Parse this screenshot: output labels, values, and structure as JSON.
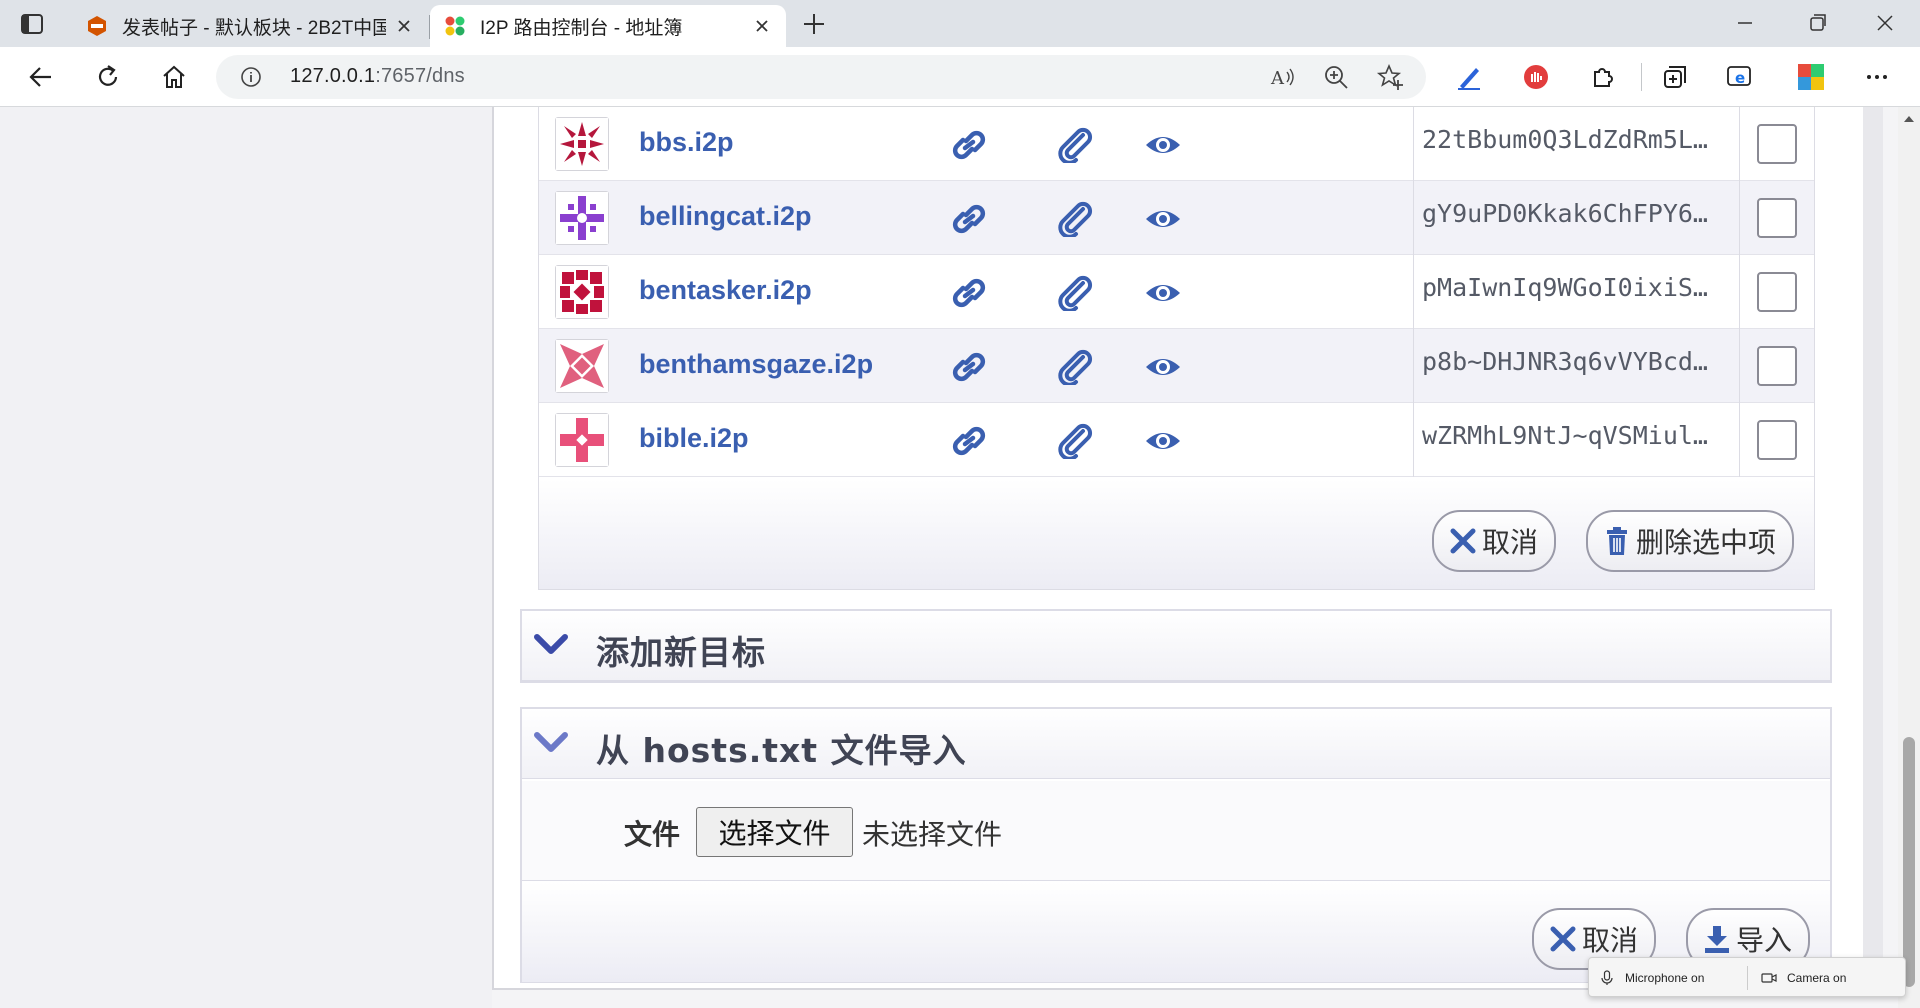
{
  "browser": {
    "tabs": [
      {
        "title": "发表帖子 - 默认板块 - 2B2T中国服",
        "active": false,
        "favicon": "forum-favicon"
      },
      {
        "title": "I2P 路由控制台 - 地址簿",
        "active": true,
        "favicon": "i2p-favicon"
      }
    ],
    "address": {
      "host": "127.0.0.1",
      "rest": ":7657/dns"
    },
    "toolbar_icons": [
      "back-icon",
      "refresh-icon",
      "home-icon",
      "read-aloud-icon",
      "zoom-icon",
      "favorite-add-icon",
      "pen-extension-icon",
      "stop-extension-icon",
      "extensions-icon",
      "collections-icon",
      "ie-mode-icon",
      "profile-icon",
      "more-icon"
    ]
  },
  "addressbook": {
    "entries": [
      {
        "name": "bbs.i2p",
        "destination": "22tBbum0Q3LdZdRm5L…",
        "ident_color": "#b5173c"
      },
      {
        "name": "bellingcat.i2p",
        "destination": "gY9uPD0Kkak6ChFPY6…",
        "ident_color": "#8a3fcf"
      },
      {
        "name": "bentasker.i2p",
        "destination": "pMaIwnIq9WGoI0ixiS…",
        "ident_color": "#c0123c"
      },
      {
        "name": "benthamsgaze.i2p",
        "destination": "p8b~DHJNR3q6vVYBcd…",
        "ident_color": "#e0607e"
      },
      {
        "name": "bible.i2p",
        "destination": "wZRMhL9NtJ~qVSMiul…",
        "ident_color": "#e8507a"
      }
    ],
    "cancel_label": "取消",
    "delete_label": "删除选中项"
  },
  "add_section": {
    "title": "添加新目标"
  },
  "import_section": {
    "title": "从 hosts.txt 文件导入",
    "file_label": "文件",
    "choose_file": "选择文件",
    "no_file": "未选择文件",
    "cancel_label": "取消",
    "import_label": "导入"
  },
  "media_indicator": {
    "microphone": "Microphone on",
    "camera": "Camera on"
  }
}
